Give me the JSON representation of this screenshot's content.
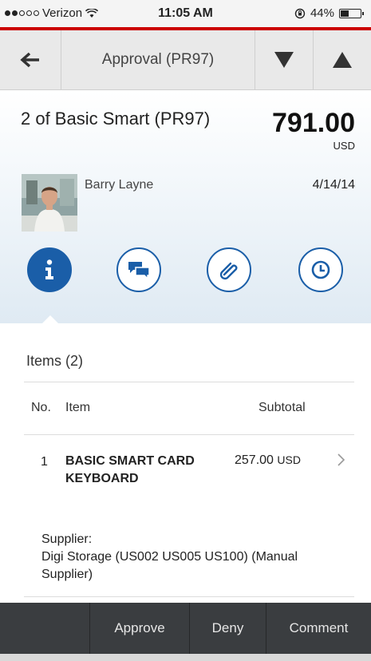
{
  "status_bar": {
    "carrier": "Verizon",
    "time": "11:05 AM",
    "battery": "44%",
    "battery_level": 0.44
  },
  "nav": {
    "title": "Approval (PR97)"
  },
  "header": {
    "title": "2 of Basic Smart (PR97)",
    "amount": "791.00",
    "currency": "USD",
    "requester": "Barry Layne",
    "date": "4/14/14"
  },
  "tabs": [
    {
      "name": "info",
      "active": true
    },
    {
      "name": "comments",
      "active": false
    },
    {
      "name": "attachments",
      "active": false
    },
    {
      "name": "history",
      "active": false
    }
  ],
  "items": {
    "title": "Items (2)",
    "columns": {
      "no": "No.",
      "item": "Item",
      "subtotal": "Subtotal"
    },
    "rows": [
      {
        "no": "1",
        "item": "BASIC SMART CARD KEYBOARD",
        "subtotal": "257.00",
        "currency": "USD"
      }
    ],
    "supplier_label": "Supplier:",
    "supplier_value": "Digi Storage (US002 US005 US100) (Manual Supplier)"
  },
  "toolbar": {
    "approve": "Approve",
    "deny": "Deny",
    "comment": "Comment"
  },
  "colors": {
    "accent": "#1a5ea8",
    "brand_bar": "#cc0000",
    "toolbar_bg": "#3a3d40"
  }
}
